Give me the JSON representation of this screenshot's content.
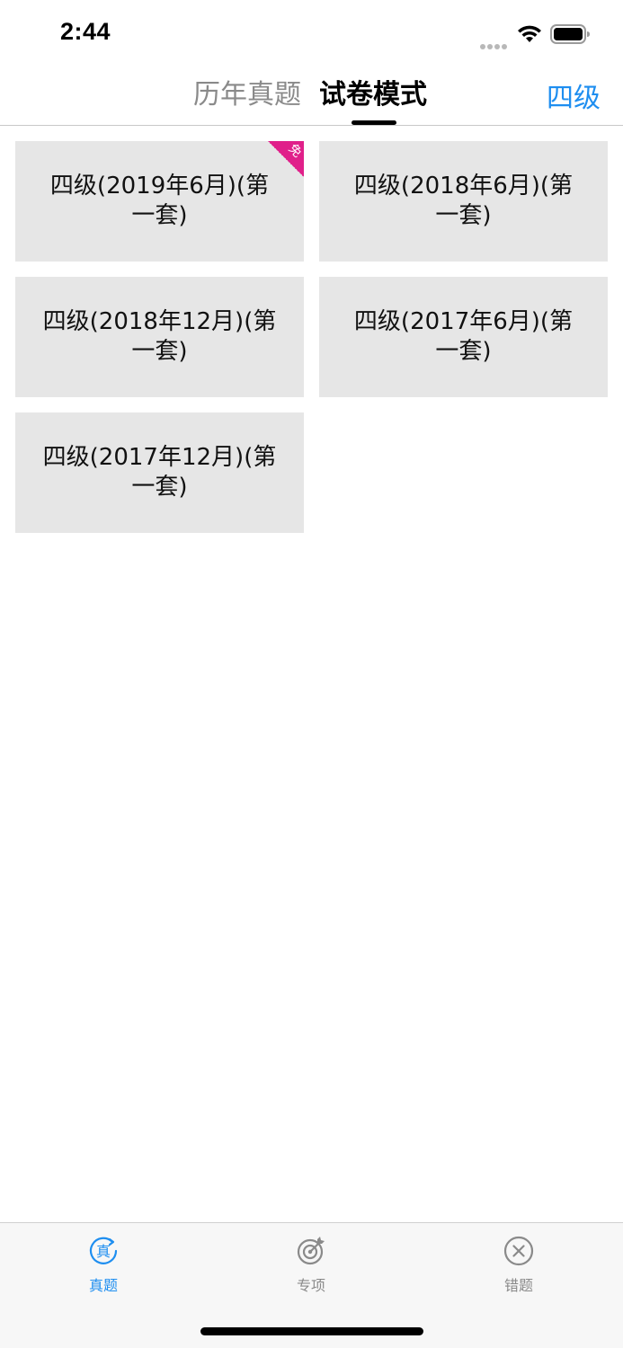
{
  "status_bar": {
    "time": "2:44"
  },
  "nav": {
    "tabs": [
      {
        "label": "历年真题",
        "active": false
      },
      {
        "label": "试卷模式",
        "active": true
      }
    ],
    "level_button": "四级"
  },
  "papers": [
    {
      "line1": "四级(2019年6月)(第",
      "line2": "一套)",
      "free_badge": "免"
    },
    {
      "line1": "四级(2018年6月)(第",
      "line2": "一套)"
    },
    {
      "line1": "四级(2018年12月)(第",
      "line2": "一套)"
    },
    {
      "line1": "四级(2017年6月)(第",
      "line2": "一套)"
    },
    {
      "line1": "四级(2017年12月)(第",
      "line2": "一套)"
    }
  ],
  "tab_bar": {
    "items": [
      {
        "label": "真题",
        "icon": "real-exam-icon",
        "icon_glyph": "真",
        "active": true
      },
      {
        "label": "专项",
        "icon": "target-icon",
        "active": false
      },
      {
        "label": "错题",
        "icon": "close-circle-icon",
        "active": false
      }
    ]
  },
  "colors": {
    "accent": "#1e8ef0",
    "inactive": "#8a8a8a",
    "card_bg": "#e6e6e6",
    "free_badge": "#e0208a"
  }
}
